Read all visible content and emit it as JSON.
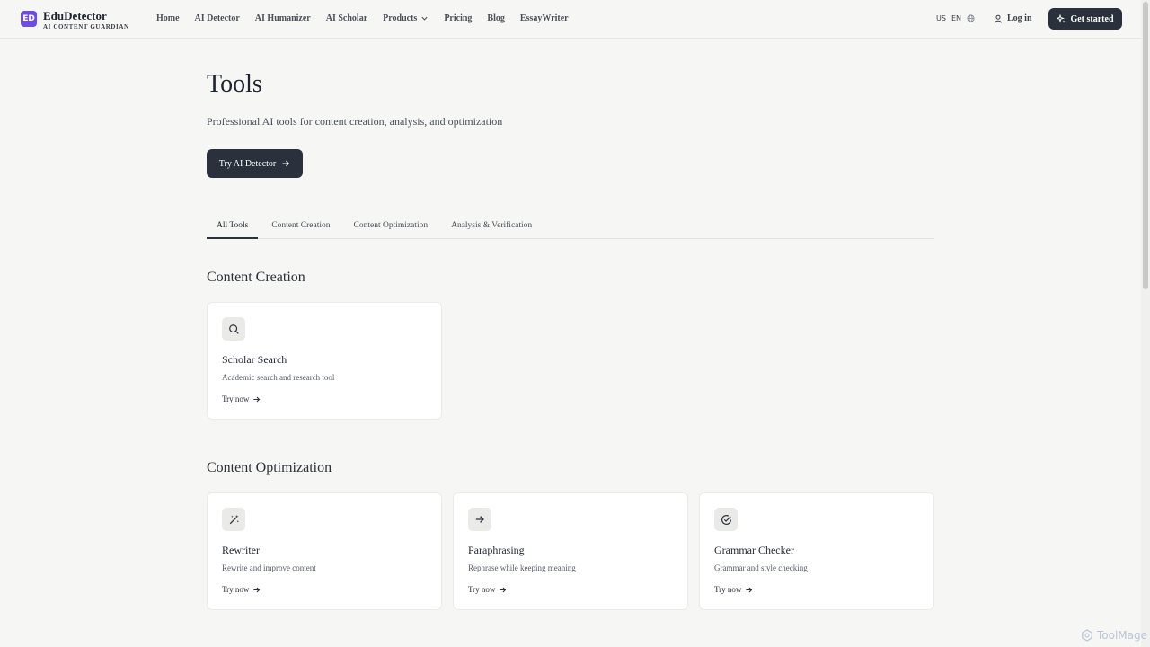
{
  "brand": {
    "badge": "ED",
    "name": "EduDetector",
    "tagline": "AI CONTENT GUARDIAN",
    "accent": "#6f4ce0"
  },
  "nav": {
    "items": [
      {
        "label": "Home"
      },
      {
        "label": "AI Detector"
      },
      {
        "label": "AI Humanizer"
      },
      {
        "label": "AI Scholar"
      },
      {
        "label": "Products"
      },
      {
        "label": "Pricing"
      },
      {
        "label": "Blog"
      },
      {
        "label": "EssayWriter"
      }
    ]
  },
  "header": {
    "region": "US",
    "language": "EN",
    "login_label": "Log in",
    "cta_label": "Get started"
  },
  "main": {
    "title": "Tools",
    "subtitle": "Professional AI tools for content creation, analysis, and optimization",
    "cta_label": "Try AI Detector",
    "tabs": [
      {
        "label": "All Tools"
      },
      {
        "label": "Content Creation"
      },
      {
        "label": "Content Optimization"
      },
      {
        "label": "Analysis & Verification"
      }
    ]
  },
  "sections": [
    {
      "title": "Content Creation",
      "cards": [
        {
          "title": "Scholar Search",
          "desc": "Academic search and research tool",
          "link": "Try now",
          "icon": "search-icon"
        }
      ]
    },
    {
      "title": "Content Optimization",
      "cards": [
        {
          "title": "Rewriter",
          "desc": "Rewrite and improve content",
          "link": "Try now",
          "icon": "magic-wand-icon"
        },
        {
          "title": "Paraphrasing",
          "desc": "Rephrase while keeping meaning",
          "link": "Try now",
          "icon": "arrow-right-icon"
        },
        {
          "title": "Grammar Checker",
          "desc": "Grammar and style checking",
          "link": "Try now",
          "icon": "check-circle-icon"
        }
      ]
    }
  ],
  "watermark": "ToolMage",
  "colors": {
    "dark_button": "#2b313c",
    "background": "#f6f6f4"
  }
}
